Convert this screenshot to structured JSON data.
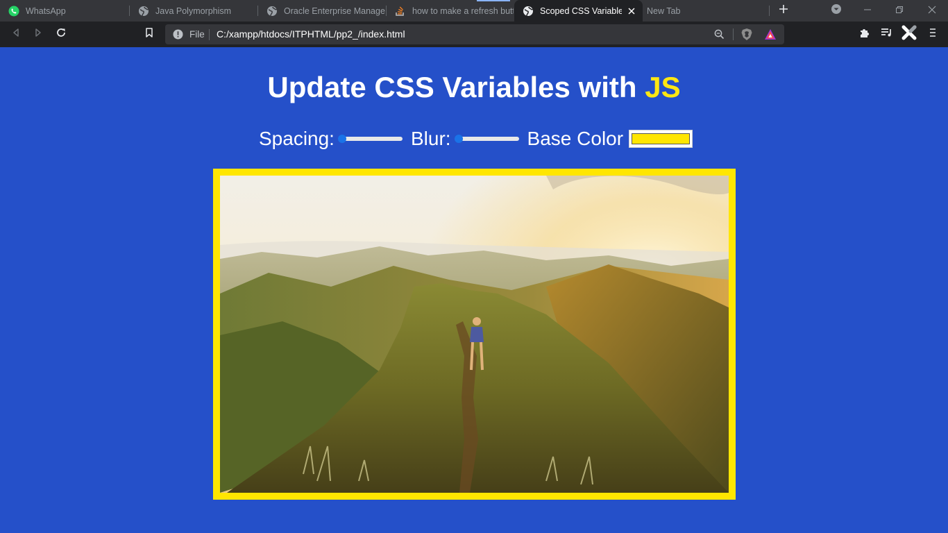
{
  "browser": {
    "tabs": [
      {
        "title": "WhatsApp",
        "icon": "whatsapp-icon",
        "active": false
      },
      {
        "title": "Java Polymorphism",
        "icon": "globe-icon",
        "active": false
      },
      {
        "title": "Oracle Enterprise Manager",
        "icon": "globe-icon",
        "active": false
      },
      {
        "title": "how to make a refresh butt",
        "icon": "stackoverflow-icon",
        "active": false
      },
      {
        "title": "Scoped CSS Variables a",
        "icon": "globe-icon",
        "active": true
      },
      {
        "title": "New Tab",
        "icon": "",
        "active": false
      }
    ],
    "address": {
      "scheme_label": "File",
      "url": "C:/xampp/htdocs/ITPHTML/pp2_/index.html"
    }
  },
  "page": {
    "heading_main": "Update CSS Variables with ",
    "heading_highlight": "JS",
    "controls": {
      "spacing_label": "Spacing:",
      "spacing_value": 0,
      "blur_label": "Blur:",
      "blur_value": 0,
      "base_color_label": "Base Color",
      "base_color_value": "#ffe600"
    },
    "photo_description_icon": "mountain-hiker-photo"
  },
  "colors": {
    "page_background": "#2550c9",
    "accent": "#ffe712",
    "frame": "#ffe600"
  }
}
